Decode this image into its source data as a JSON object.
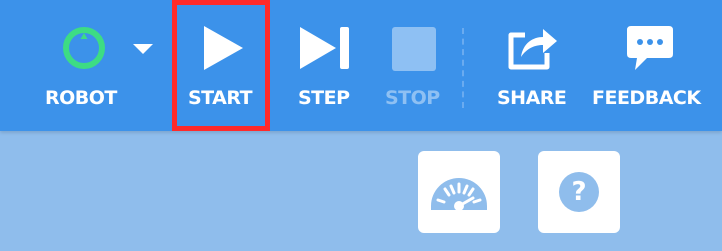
{
  "toolbar": {
    "robot": {
      "label": "ROBOT",
      "icon": "robot-ring-icon",
      "status_color": "#3ddc84"
    },
    "robot_menu_icon": "caret-down-icon",
    "start": {
      "label": "START",
      "icon": "play-icon",
      "highlighted": true
    },
    "step": {
      "label": "STEP",
      "icon": "step-forward-icon"
    },
    "stop": {
      "label": "STOP",
      "icon": "stop-icon",
      "disabled": true
    },
    "share": {
      "label": "SHARE",
      "icon": "share-icon"
    },
    "feedback": {
      "label": "FEEDBACK",
      "icon": "chat-bubble-icon"
    }
  },
  "tiles": {
    "gauge": {
      "icon": "speedometer-icon"
    },
    "help": {
      "icon": "question-icon",
      "glyph": "?"
    }
  },
  "colors": {
    "toolbar_bg": "#3c92ea",
    "canvas_bg": "#8fbdec",
    "highlight": "#ff2a2a",
    "disabled": "#8ec0f3"
  }
}
